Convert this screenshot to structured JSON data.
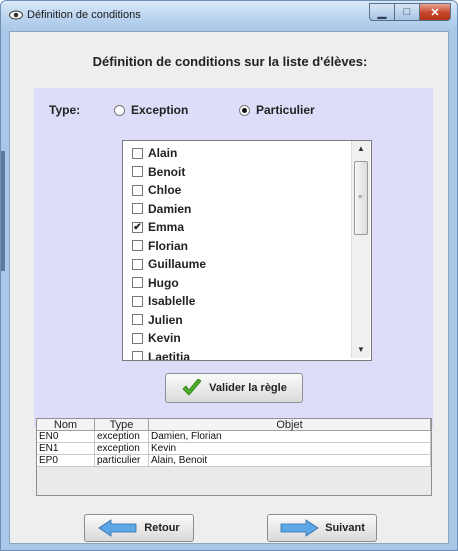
{
  "window": {
    "title": "Définition de conditions"
  },
  "header": {
    "text": "Définition de conditions sur la liste d'élèves:"
  },
  "type": {
    "label": "Type:",
    "options": [
      {
        "label": "Exception",
        "selected": false
      },
      {
        "label": "Particulier",
        "selected": true
      }
    ]
  },
  "students": [
    {
      "name": "Alain",
      "checked": false
    },
    {
      "name": "Benoit",
      "checked": false
    },
    {
      "name": "Chloe",
      "checked": false
    },
    {
      "name": "Damien",
      "checked": false
    },
    {
      "name": "Emma",
      "checked": true
    },
    {
      "name": "Florian",
      "checked": false
    },
    {
      "name": "Guillaume",
      "checked": false
    },
    {
      "name": "Hugo",
      "checked": false
    },
    {
      "name": "Isablelle",
      "checked": false
    },
    {
      "name": "Julien",
      "checked": false
    },
    {
      "name": "Kevin",
      "checked": false
    },
    {
      "name": "Laetitia",
      "checked": false
    }
  ],
  "validate_label": "Valider la règle",
  "table": {
    "headers": [
      "Nom",
      "Type",
      "Objet"
    ],
    "rows": [
      [
        "EN0",
        "exception",
        "Damien, Florian"
      ],
      [
        "EN1",
        "exception",
        "Kevin"
      ],
      [
        "EP0",
        "particulier",
        "Alain, Benoit"
      ]
    ]
  },
  "nav": {
    "back_label": "Retour",
    "next_label": "Suivant"
  },
  "colors": {
    "panel": "#ddddfa",
    "check_icon": "#4caf2a",
    "arrow_icon": "#5aa9e6"
  }
}
